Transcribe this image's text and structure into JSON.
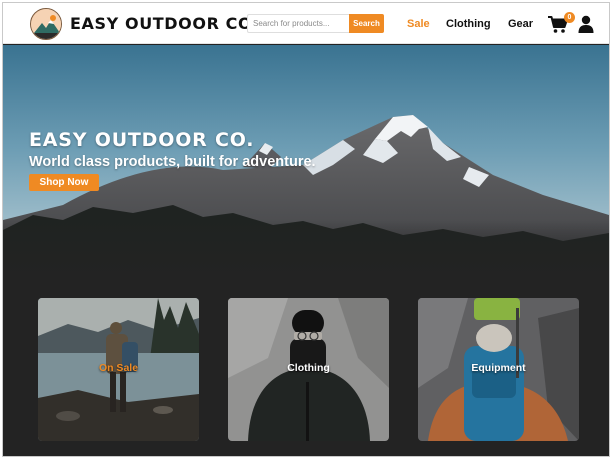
{
  "header": {
    "brand": "EASY OUTDOOR CO.",
    "logo_text": "EASY OUTDOOR",
    "search": {
      "placeholder": "Search for products...",
      "value": "",
      "button_label": "Search"
    },
    "nav": {
      "sale": "Sale",
      "clothing": "Clothing",
      "gear": "Gear"
    },
    "cart_count": "0",
    "icons": {
      "cart": "cart-icon",
      "user": "user-icon"
    }
  },
  "hero": {
    "title": "EASY OUTDOOR CO.",
    "subtitle": "World class products, built for adventure.",
    "cta_label": "Shop Now"
  },
  "categories": [
    {
      "label": "On Sale"
    },
    {
      "label": "Clothing"
    },
    {
      "label": "Equipment"
    }
  ],
  "colors": {
    "accent": "#ef8a23",
    "page_background": "#232323",
    "header_background": "#ffffff"
  }
}
